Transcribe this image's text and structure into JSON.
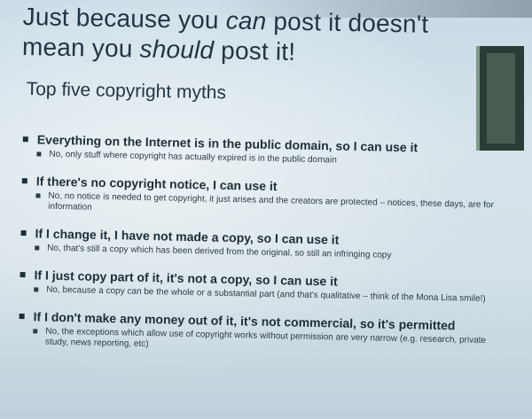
{
  "slide": {
    "title_line1_a": "Just because you ",
    "title_line1_em": "can",
    "title_line1_b": " post it doesn't",
    "title_line2_a": "mean you ",
    "title_line2_em": "should",
    "title_line2_b": " post it!",
    "subtitle": "Top five copyright myths"
  },
  "myths": [
    {
      "myth": "Everything on the Internet is in the public domain, so I can use it",
      "rebuttal": "No, only stuff where copyright has actually expired is in the public domain"
    },
    {
      "myth": "If there's no copyright notice, I can use it",
      "rebuttal": "No, no notice is needed to get copyright, it just arises and the creators are protected – notices, these days, are for information"
    },
    {
      "myth": "If I change it, I have not made a copy, so I can use it",
      "rebuttal": "No, that's still a copy which has been derived from the original, so still an infringing copy"
    },
    {
      "myth": "If I just copy part of it, it's not a copy, so I can use it",
      "rebuttal": "No, because a copy can be the whole or a substantial part (and that's qualitative – think of the Mona Lisa smile!)"
    },
    {
      "myth": "If I don't make any money out of it, it's not commercial, so it's permitted",
      "rebuttal": "No, the exceptions which allow use of copyright works without permission are very narrow (e.g. research, private study, news reporting, etc)"
    }
  ],
  "colors": {
    "background": "#d3e0e7",
    "text": "#1e2e38",
    "side_block": "#2b3b36"
  }
}
